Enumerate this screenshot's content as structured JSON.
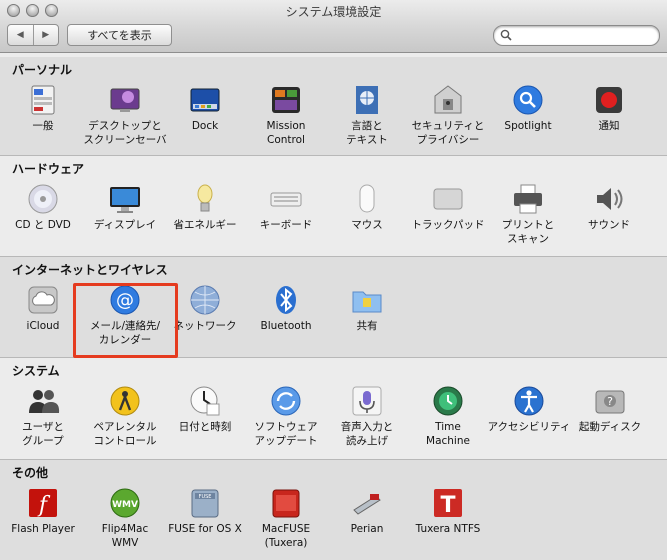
{
  "window": {
    "title": "システム環境設定"
  },
  "toolbar": {
    "back": "◀",
    "forward": "▶",
    "show_all": "すべてを表示",
    "search_value": ""
  },
  "sections": [
    {
      "title": "パーソナル",
      "items": [
        {
          "label": "一般",
          "icon": "general-icon"
        },
        {
          "label": "デスクトップと\nスクリーンセーバ",
          "icon": "desktop-icon"
        },
        {
          "label": "Dock",
          "icon": "dock-icon"
        },
        {
          "label": "Mission\nControl",
          "icon": "mission-control-icon"
        },
        {
          "label": "言語と\nテキスト",
          "icon": "language-icon"
        },
        {
          "label": "セキュリティと\nプライバシー",
          "icon": "security-icon"
        },
        {
          "label": "Spotlight",
          "icon": "spotlight-icon"
        },
        {
          "label": "通知",
          "icon": "notifications-icon"
        }
      ]
    },
    {
      "title": "ハードウェア",
      "items": [
        {
          "label": "CD と DVD",
          "icon": "cd-dvd-icon"
        },
        {
          "label": "ディスプレイ",
          "icon": "display-icon"
        },
        {
          "label": "省エネルギー",
          "icon": "energy-saver-icon"
        },
        {
          "label": "キーボード",
          "icon": "keyboard-icon"
        },
        {
          "label": "マウス",
          "icon": "mouse-icon"
        },
        {
          "label": "トラックパッド",
          "icon": "trackpad-icon"
        },
        {
          "label": "プリントと\nスキャン",
          "icon": "printer-icon"
        },
        {
          "label": "サウンド",
          "icon": "sound-icon"
        }
      ]
    },
    {
      "title": "インターネットとワイヤレス",
      "items": [
        {
          "label": "iCloud",
          "icon": "icloud-icon"
        },
        {
          "label": "メール/連絡先/\nカレンダー",
          "icon": "mail-contacts-icon"
        },
        {
          "label": "ネットワーク",
          "icon": "network-icon"
        },
        {
          "label": "Bluetooth",
          "icon": "bluetooth-icon"
        },
        {
          "label": "共有",
          "icon": "sharing-icon"
        }
      ]
    },
    {
      "title": "システム",
      "items": [
        {
          "label": "ユーザと\nグループ",
          "icon": "users-groups-icon"
        },
        {
          "label": "ペアレンタル\nコントロール",
          "icon": "parental-controls-icon"
        },
        {
          "label": "日付と時刻",
          "icon": "date-time-icon"
        },
        {
          "label": "ソフトウェア\nアップデート",
          "icon": "software-update-icon"
        },
        {
          "label": "音声入力と\n読み上げ",
          "icon": "dictation-icon"
        },
        {
          "label": "Time\nMachine",
          "icon": "time-machine-icon"
        },
        {
          "label": "アクセシビリティ",
          "icon": "accessibility-icon"
        },
        {
          "label": "起動ディスク",
          "icon": "startup-disk-icon"
        }
      ]
    },
    {
      "title": "その他",
      "items": [
        {
          "label": "Flash Player",
          "icon": "flash-player-icon"
        },
        {
          "label": "Flip4Mac\nWMV",
          "icon": "flip4mac-icon"
        },
        {
          "label": "FUSE for OS X",
          "icon": "fuse-icon"
        },
        {
          "label": "MacFUSE\n(Tuxera)",
          "icon": "macfuse-icon"
        },
        {
          "label": "Perian",
          "icon": "perian-icon"
        },
        {
          "label": "Tuxera NTFS",
          "icon": "tuxera-ntfs-icon"
        }
      ]
    }
  ],
  "colors": {
    "highlight": "#e53b1f"
  }
}
